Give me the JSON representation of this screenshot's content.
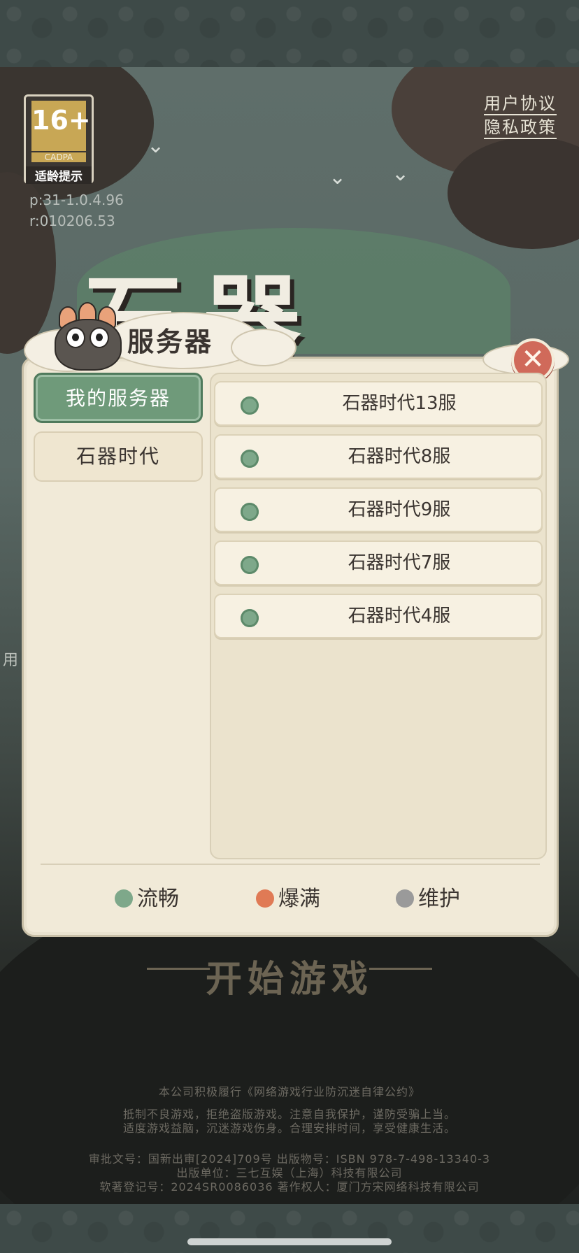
{
  "top_links": {
    "user_agreement": "用户协议",
    "privacy_policy": "隐私政策"
  },
  "age_rating": {
    "number": "16+",
    "org": "CADPA",
    "hint": "适龄提示"
  },
  "version": {
    "p": "p:31-1.0.4.96",
    "r": "r:010206.53"
  },
  "panel": {
    "title": "服务器",
    "categories": [
      {
        "label": "我的服务器",
        "active": true
      },
      {
        "label": "石器时代",
        "active": false
      }
    ],
    "servers": [
      {
        "name": "石器时代13服",
        "status": "流畅"
      },
      {
        "name": "石器时代8服",
        "status": "流畅"
      },
      {
        "name": "石器时代9服",
        "status": "流畅"
      },
      {
        "name": "石器时代7服",
        "status": "流畅"
      },
      {
        "name": "石器时代4服",
        "status": "流畅"
      }
    ],
    "legend": [
      {
        "label": "流畅",
        "color": "#7ea88a"
      },
      {
        "label": "爆满",
        "color": "#e07a55"
      },
      {
        "label": "维护",
        "color": "#9a9a9a"
      }
    ],
    "close_icon": "close-icon"
  },
  "start_button": "开始游戏",
  "notices": {
    "line1": "本公司积极履行《网络游戏行业防沉迷自律公约》",
    "line2": "抵制不良游戏，拒绝盗版游戏。注意自我保护，谨防受骗上当。",
    "line3": "适度游戏益脑，沉迷游戏伤身。合理安排时间，享受健康生活。",
    "line4": "审批文号：国新出审[2024]709号 出版物号：ISBN 978-7-498-13340-3",
    "line5": "出版单位：三七互娱（上海）科技有限公司",
    "line6": "软著登记号：2024SR0086036 著作权人：厦门方宋网络科技有限公司"
  },
  "partial_label": "用"
}
